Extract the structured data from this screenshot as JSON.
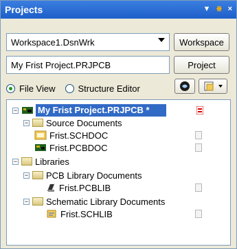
{
  "panel": {
    "title": "Projects",
    "controls": {
      "menu": "▼",
      "pin": "⧻",
      "close": "×"
    }
  },
  "workspace": {
    "value": "Workspace1.DsnWrk",
    "button_label": "Workspace"
  },
  "project": {
    "value": "My Frist Project.PRJPCB",
    "button_label": "Project"
  },
  "view_modes": {
    "file_view": "File View",
    "structure_editor": "Structure Editor",
    "selected": "File View"
  },
  "tree": {
    "root_label": "My Frist Project.PRJPCB *",
    "source_docs_label": "Source Documents",
    "sch_doc_label": "Frist.SCHDOC",
    "pcb_doc_label": "Frist.PCBDOC",
    "libraries_label": "Libraries",
    "pcb_lib_docs_label": "PCB Library Documents",
    "pcb_lib_label": "Frist.PCBLIB",
    "sch_lib_docs_label": "Schematic Library Documents",
    "sch_lib_label": "Frist.SCHLIB"
  },
  "icons": {
    "project": "project-board-icon",
    "folder": "folder-icon",
    "schematic": "schematic-doc-icon",
    "pcb": "pcb-doc-icon",
    "pcb_lib": "pcb-library-icon",
    "sch_lib": "schematic-library-icon",
    "document": "document-icon",
    "modified_document": "modified-document-icon"
  },
  "colors": {
    "title_bar": "#1d5fc9",
    "selection": "#316ac5",
    "panel_bg": "#ece9d8"
  }
}
